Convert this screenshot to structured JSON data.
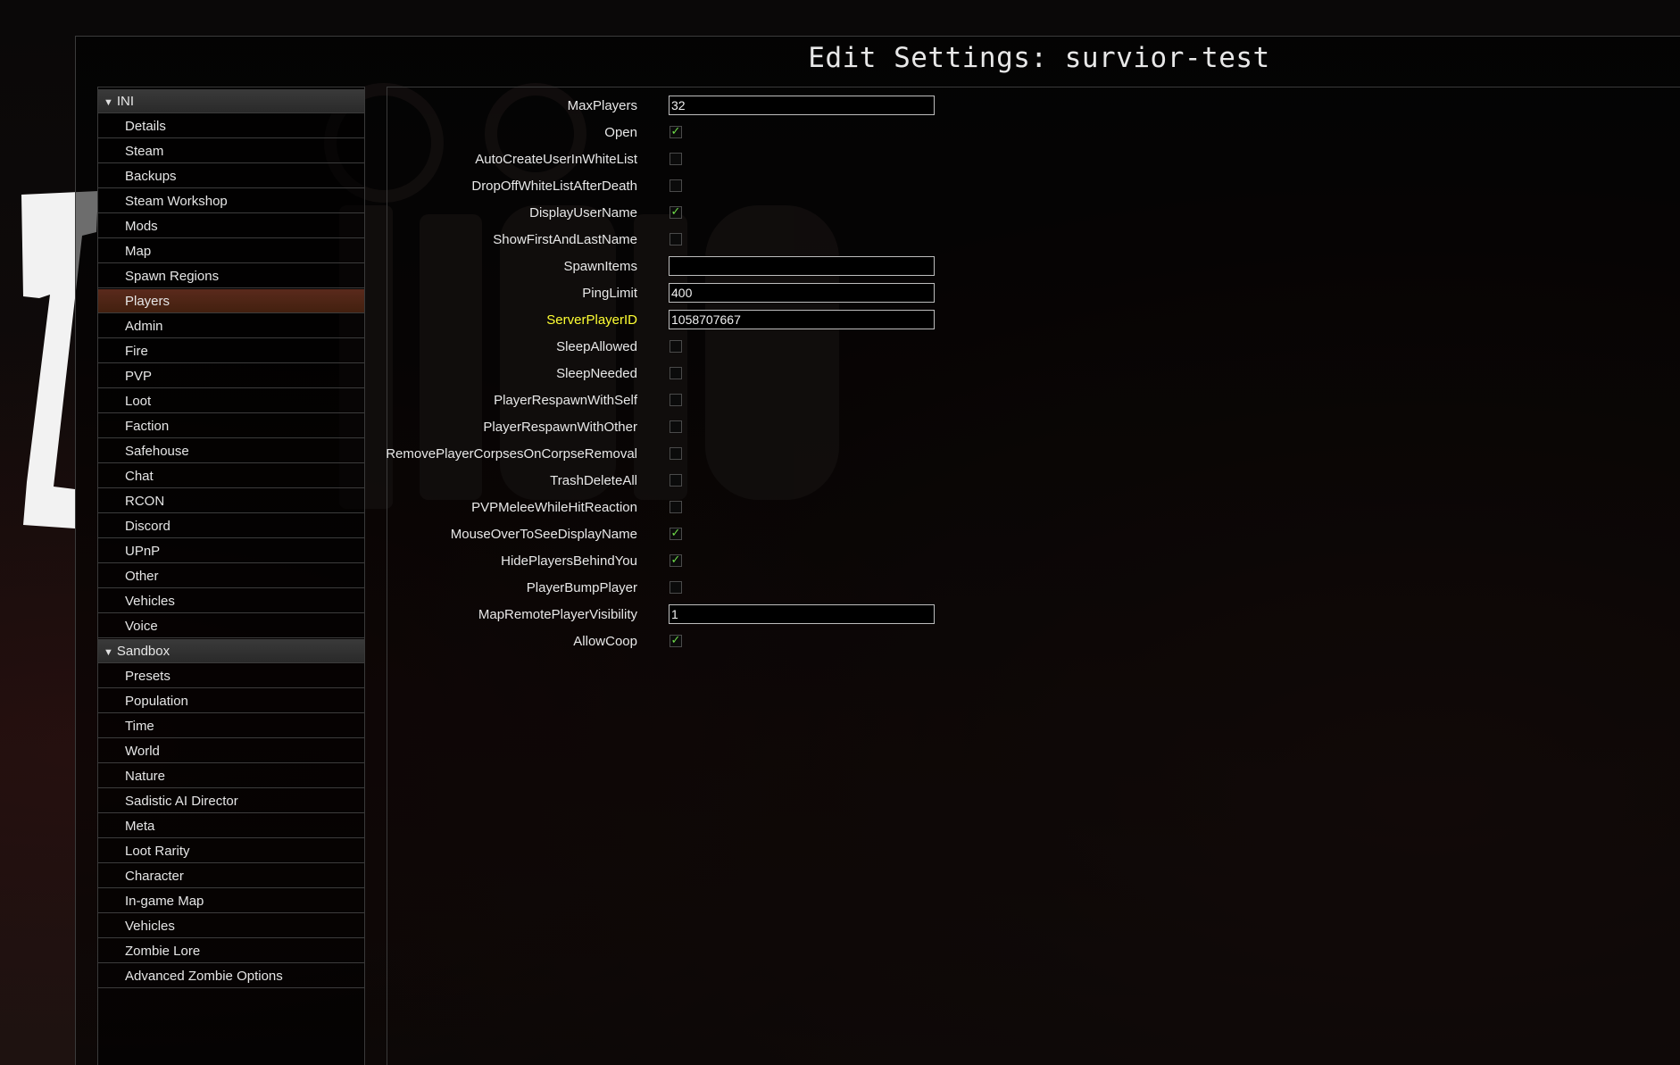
{
  "window": {
    "title": "Edit Settings: survior-test"
  },
  "sidebar": {
    "sections": [
      {
        "label": "INI",
        "expanded": true,
        "items": [
          "Details",
          "Steam",
          "Backups",
          "Steam Workshop",
          "Mods",
          "Map",
          "Spawn Regions",
          "Players",
          "Admin",
          "Fire",
          "PVP",
          "Loot",
          "Faction",
          "Safehouse",
          "Chat",
          "RCON",
          "Discord",
          "UPnP",
          "Other",
          "Vehicles",
          "Voice"
        ]
      },
      {
        "label": "Sandbox",
        "expanded": true,
        "items": [
          "Presets",
          "Population",
          "Time",
          "World",
          "Nature",
          "Sadistic AI Director",
          "Meta",
          "Loot Rarity",
          "Character",
          "In-game Map",
          "Vehicles",
          "Zombie Lore",
          "Advanced Zombie Options"
        ]
      }
    ],
    "selected": "Players"
  },
  "settings": [
    {
      "label": "MaxPlayers",
      "type": "text",
      "value": "32"
    },
    {
      "label": "Open",
      "type": "checkbox",
      "checked": true
    },
    {
      "label": "AutoCreateUserInWhiteList",
      "type": "checkbox",
      "checked": false
    },
    {
      "label": "DropOffWhiteListAfterDeath",
      "type": "checkbox",
      "checked": false
    },
    {
      "label": "DisplayUserName",
      "type": "checkbox",
      "checked": true
    },
    {
      "label": "ShowFirstAndLastName",
      "type": "checkbox",
      "checked": false
    },
    {
      "label": "SpawnItems",
      "type": "text",
      "value": ""
    },
    {
      "label": "PingLimit",
      "type": "text",
      "value": "400"
    },
    {
      "label": "ServerPlayerID",
      "type": "text",
      "value": "1058707667",
      "highlighted": true
    },
    {
      "label": "SleepAllowed",
      "type": "checkbox",
      "checked": false
    },
    {
      "label": "SleepNeeded",
      "type": "checkbox",
      "checked": false
    },
    {
      "label": "PlayerRespawnWithSelf",
      "type": "checkbox",
      "checked": false
    },
    {
      "label": "PlayerRespawnWithOther",
      "type": "checkbox",
      "checked": false
    },
    {
      "label": "RemovePlayerCorpsesOnCorpseRemoval",
      "type": "checkbox",
      "checked": false
    },
    {
      "label": "TrashDeleteAll",
      "type": "checkbox",
      "checked": false
    },
    {
      "label": "PVPMeleeWhileHitReaction",
      "type": "checkbox",
      "checked": false
    },
    {
      "label": "MouseOverToSeeDisplayName",
      "type": "checkbox",
      "checked": true
    },
    {
      "label": "HidePlayersBehindYou",
      "type": "checkbox",
      "checked": true
    },
    {
      "label": "PlayerBumpPlayer",
      "type": "checkbox",
      "checked": false
    },
    {
      "label": "MapRemotePlayerVisibility",
      "type": "text",
      "value": "1"
    },
    {
      "label": "AllowCoop",
      "type": "checkbox",
      "checked": true
    }
  ],
  "colors": {
    "highlight_label": "#ffff33",
    "checkmark": "#6fdc4a",
    "selected_item": "#5a2a1c"
  },
  "icons": {
    "expand": "triangle-down-icon",
    "check": "checkmark-icon"
  }
}
